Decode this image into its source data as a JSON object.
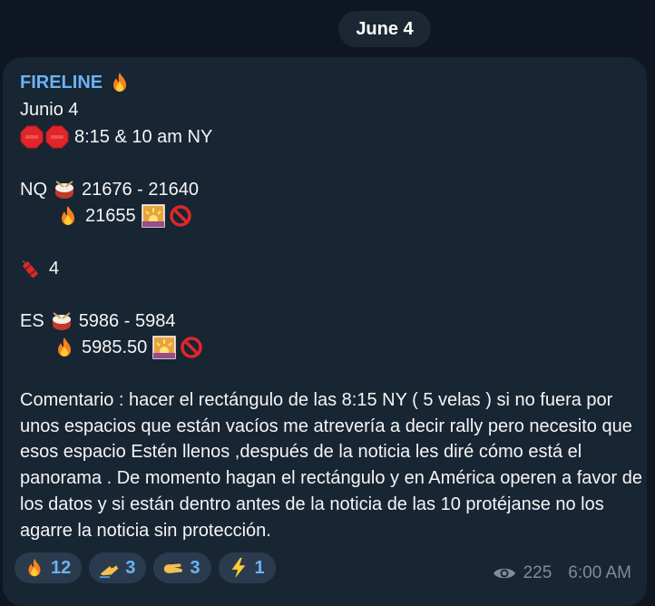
{
  "date_pill": "June 4",
  "message": {
    "sender": "FIRELINE",
    "lines": {
      "date": "Junio 4",
      "time": "8:15 & 10 am NY",
      "nq_range": "NQ",
      "nq_range_value": "21676 - 21640",
      "nq_target": "21655",
      "count": "4",
      "es_range": "ES",
      "es_range_value": "5986 - 5984",
      "es_target": "5985.50"
    },
    "comment": "Comentario : hacer el rectángulo de las 8:15 NY ( 5 velas ) si no fuera por unos espacios que están vacíos me atrevería a decir rally pero necesito que esos espacio Estén llenos ,después de la noticia les diré cómo está el panorama . De momento hagan el rectángulo y en América operen a favor de los datos y si están dentro antes de la noticia de las 10 protéjanse  no los agarre la noticia sin protección."
  },
  "reactions": [
    {
      "icon": "fire-icon",
      "count": "12"
    },
    {
      "icon": "writing-hand-icon",
      "count": "3"
    },
    {
      "icon": "pinching-hand-icon",
      "count": "3"
    },
    {
      "icon": "lightning-icon",
      "count": "1"
    }
  ],
  "meta": {
    "views": "225",
    "time": "6:00 AM"
  },
  "colors": {
    "background": "#0e1621",
    "bubble": "#182533",
    "accent": "#6ab3f3",
    "muted": "#7d8c9b"
  }
}
